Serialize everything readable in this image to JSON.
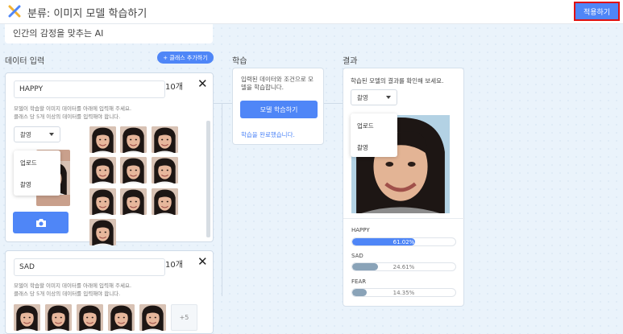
{
  "header": {
    "title": "분류: 이미지 모델 학습하기",
    "apply_label": "적용하기",
    "logo_icon": "x-logo-icon"
  },
  "ai_description": "인간의 감정을 맞추는 AI",
  "data_input": {
    "label": "데이터 입력",
    "add_class_label": "+ 클래스 추가하기"
  },
  "classes": [
    {
      "name": "HAPPY",
      "count": "10개",
      "hint_line1": "모델이 학습할 이미지 데이터를 아래에 입력해 주세요.",
      "hint_line2": "클래스 당 5개 이상의 데이터를 입력해야 합니다.",
      "dropdown_value": "촬영",
      "menu_items": [
        "업로드",
        "촬영"
      ]
    },
    {
      "name": "SAD",
      "count": "10개",
      "hint_line1": "모델이 학습할 이미지 데이터를 아래에 입력해 주세요.",
      "hint_line2": "클래스 당 5개 이상의 데이터를 입력해야 합니다.",
      "more_label": "+5"
    }
  ],
  "training": {
    "label": "학습",
    "description": "입력된 데이터와 조건으로 모델을 학습합니다.",
    "button_label": "모델 학습하기",
    "done_text": "학습을 완료했습니다."
  },
  "result": {
    "label": "결과",
    "description": "학습된 모델의 결과를 확인해 보세요.",
    "dropdown_value": "촬영",
    "menu_items": [
      "업로드",
      "촬영"
    ],
    "bars": [
      {
        "label": "HAPPY",
        "value": 61.02,
        "text": "61.02%",
        "color": "#4f86f7"
      },
      {
        "label": "SAD",
        "value": 24.61,
        "text": "24.61%",
        "color": "#8aa3b8"
      },
      {
        "label": "FEAR",
        "value": 14.35,
        "text": "14.35%",
        "color": "#8aa3b8"
      }
    ]
  },
  "colors": {
    "accent": "#4f86f7",
    "highlight_border": "#e01010"
  }
}
